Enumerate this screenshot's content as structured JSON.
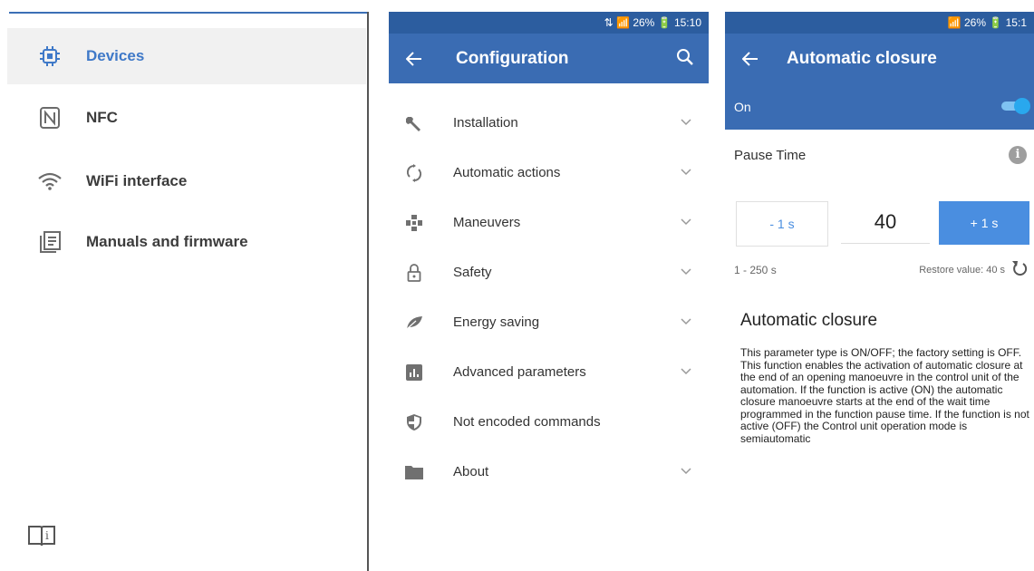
{
  "drawer": {
    "items": [
      {
        "label": "Devices",
        "icon": "chip-icon",
        "active": true
      },
      {
        "label": "NFC",
        "icon": "nfc-icon"
      },
      {
        "label": "WiFi interface",
        "icon": "wifi-icon"
      },
      {
        "label": "Manuals and firmware",
        "icon": "manuals-icon"
      }
    ],
    "footer_icon": "help-book-icon",
    "active_color": "#3f79c8"
  },
  "config_screen": {
    "status": "⇅ 📶 26% 🔋 15:10",
    "title": "Configuration",
    "items": [
      {
        "label": "Installation",
        "icon": "wrench-icon",
        "expandable": true
      },
      {
        "label": "Automatic actions",
        "icon": "sync-icon",
        "expandable": true
      },
      {
        "label": "Maneuvers",
        "icon": "maneuvers-icon",
        "expandable": true
      },
      {
        "label": "Safety",
        "icon": "padlock-icon",
        "expandable": true
      },
      {
        "label": "Energy saving",
        "icon": "leaf-icon",
        "expandable": true
      },
      {
        "label": "Advanced parameters",
        "icon": "bar-chart-icon",
        "expandable": true
      },
      {
        "label": "Not encoded commands",
        "icon": "shield-icon",
        "expandable": false
      },
      {
        "label": "About",
        "icon": "folder-icon",
        "expandable": true
      }
    ],
    "header_color": "#3a6cb3"
  },
  "closure_screen": {
    "status": "📶 26% 🔋 15:1",
    "title": "Automatic closure",
    "toggle": {
      "label": "On",
      "value": true
    },
    "pause": {
      "label": "Pause Time",
      "minus_label": "- 1 s",
      "value": "40",
      "plus_label": "+ 1 s",
      "range": "1 - 250 s",
      "restore": "Restore value: 40 s"
    },
    "section_title": "Automatic closure",
    "description": "This parameter type is ON/OFF; the factory setting is OFF. This function enables the activation of automatic closure at the end of an opening manoeuvre in the control unit of the automation. If the function is active (ON) the automatic closure manoeuvre starts at the end of the wait time programmed in the function pause time. If the function is not active (OFF) the Control unit operation mode is semiautomatic",
    "accent_color": "#4a8ee0"
  }
}
